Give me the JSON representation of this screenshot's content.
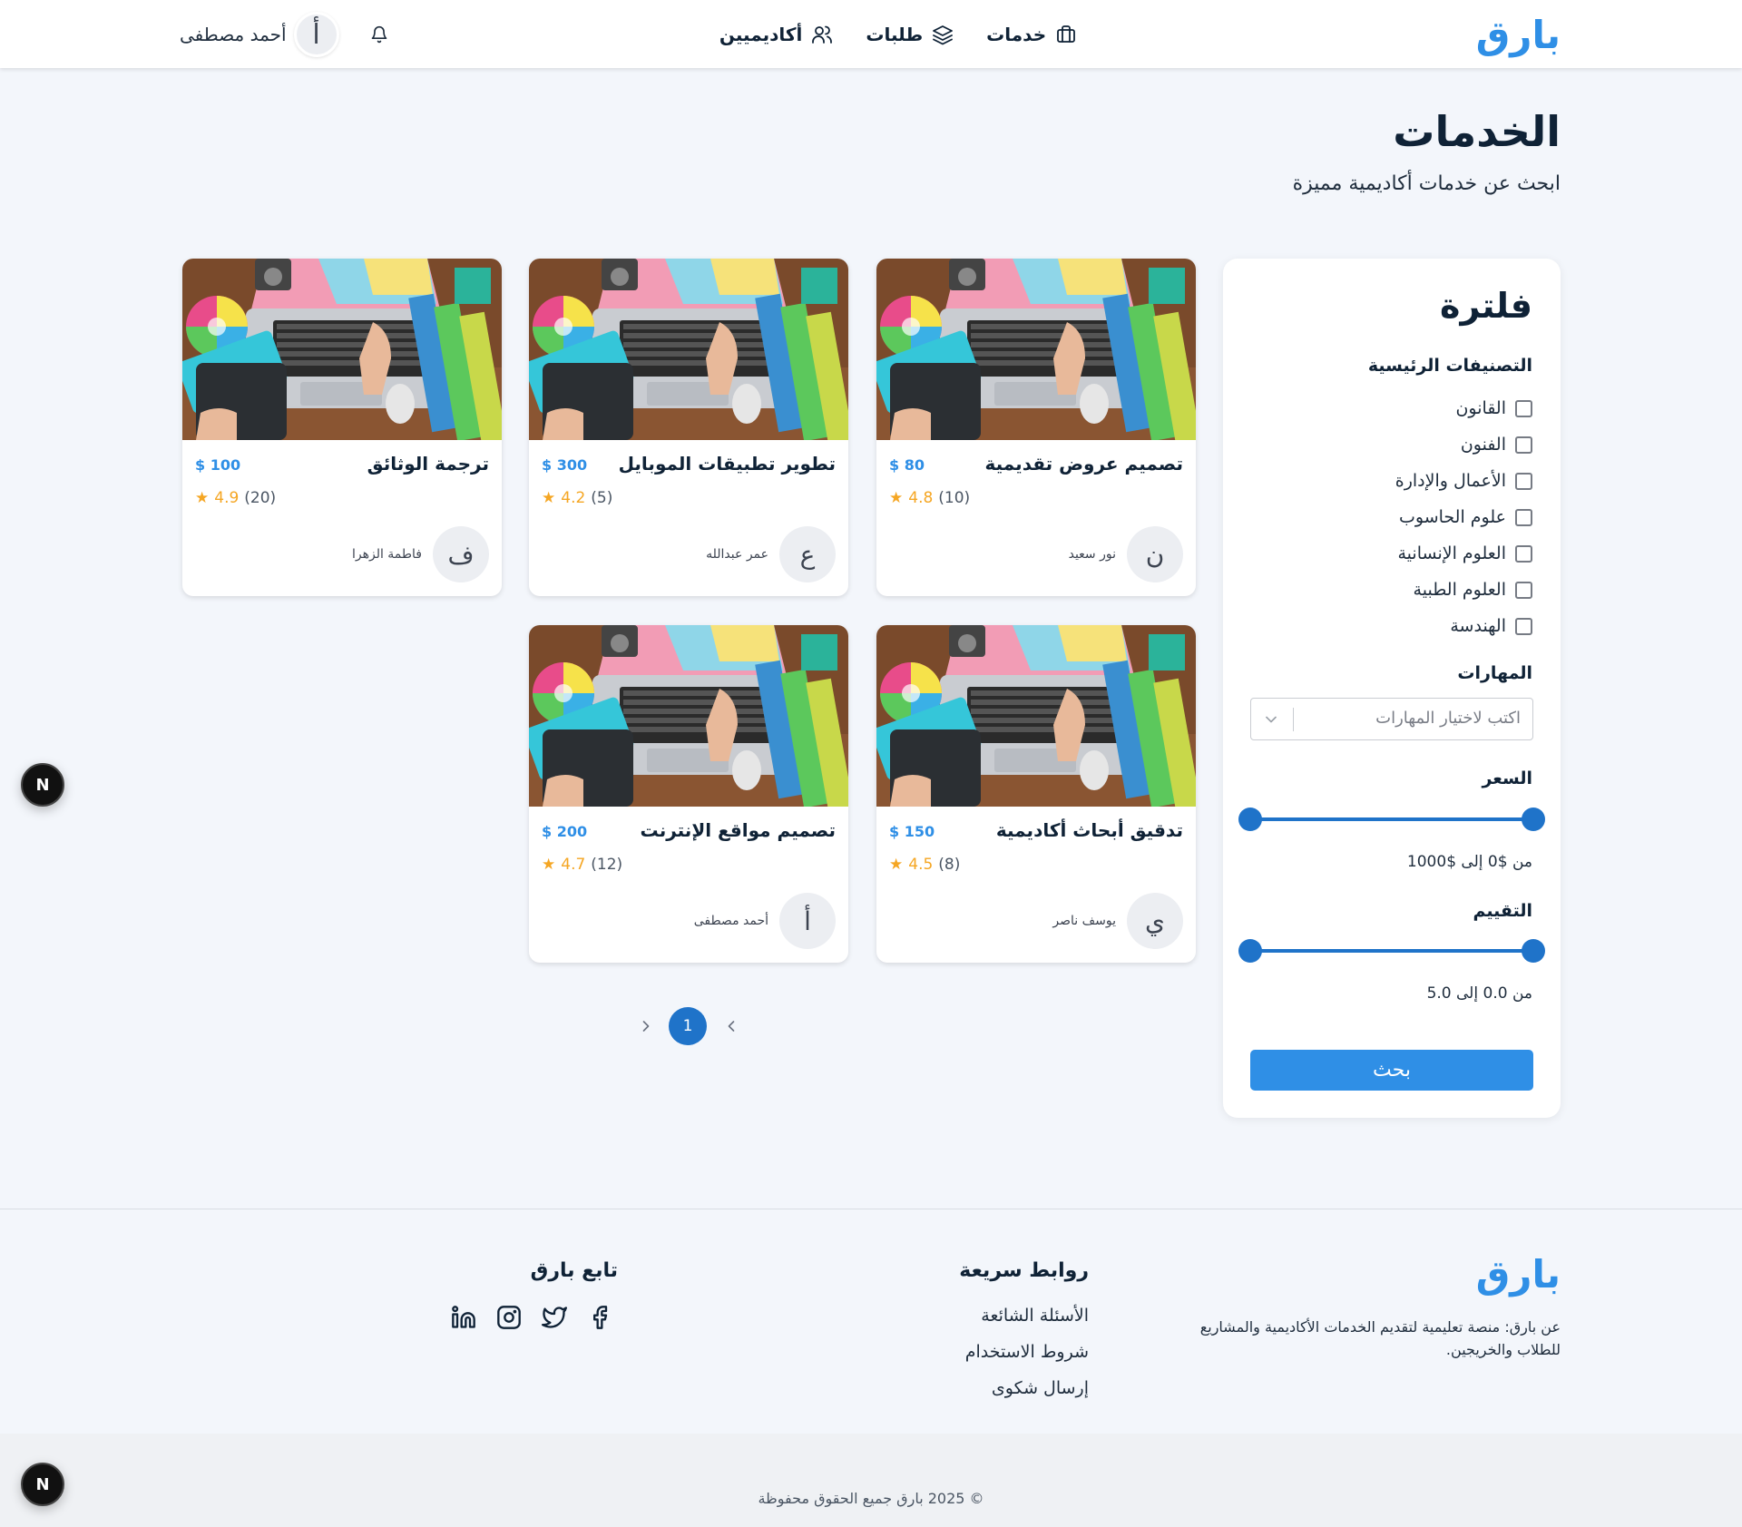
{
  "header": {
    "brand": "بارق",
    "nav": [
      {
        "label": "خدمات",
        "icon": "briefcase-icon"
      },
      {
        "label": "طلبات",
        "icon": "layers-icon"
      },
      {
        "label": "أكاديميين",
        "icon": "users-icon"
      }
    ],
    "user": {
      "name": "أحمد مصطفى",
      "initial": "أ"
    },
    "bell_icon": "bell-icon"
  },
  "page": {
    "title": "الخدمات",
    "subtitle": "ابحث عن خدمات أكاديمية مميزة"
  },
  "filter": {
    "title": "فلترة",
    "categories_title": "التصنيفات الرئيسية",
    "categories": [
      "القانون",
      "الفنون",
      "الأعمال والإدارة",
      "علوم الحاسوب",
      "العلوم الإنسانية",
      "العلوم الطبية",
      "الهندسة"
    ],
    "skills_title": "المهارات",
    "skills_placeholder": "اكتب لاختيار المهارات",
    "price_title": "السعر",
    "price_range_text": "من $0 إلى $1000",
    "rating_title": "التقييم",
    "rating_range_text": "من 0.0 إلى 5.0",
    "search_label": "بحث"
  },
  "cards": [
    {
      "title": "تصميم عروض تقديمية",
      "price": "$ 80",
      "rating": "4.8",
      "count": "(10)",
      "author": "نور سعيد",
      "initial": "ن"
    },
    {
      "title": "تطوير تطبيقات الموبايل",
      "price": "$ 300",
      "rating": "4.2",
      "count": "(5)",
      "author": "عمر عبدالله",
      "initial": "ع"
    },
    {
      "title": "ترجمة الوثائق",
      "price": "$ 100",
      "rating": "4.9",
      "count": "(20)",
      "author": "فاطمة الزهرا",
      "initial": "ف"
    },
    {
      "title": "تدقيق أبحاث أكاديمية",
      "price": "$ 150",
      "rating": "4.5",
      "count": "(8)",
      "author": "يوسف ناصر",
      "initial": "ي"
    },
    {
      "title": "تصميم مواقع الإنترنت",
      "price": "$ 200",
      "rating": "4.7",
      "count": "(12)",
      "author": "أحمد مصطفى",
      "initial": "أ"
    }
  ],
  "pagination": {
    "current": "1"
  },
  "floating_badges": [
    "N",
    "N"
  ],
  "footer": {
    "brand": "بارق",
    "about": "عن بارق: منصة تعليمية لتقديم الخدمات الأكاديمية والمشاريع للطلاب والخريجين.",
    "quick_links_title": "روابط سريعة",
    "quick_links": [
      "الأسئلة الشائعة",
      "شروط الاستخدام",
      "إرسال شكوى"
    ],
    "follow_title": "تابع بارق",
    "social_icons": [
      "facebook-icon",
      "twitter-icon",
      "instagram-icon",
      "linkedin-icon"
    ],
    "copyright": "© 2025 بارق جميع الحقوق محفوظة"
  },
  "colors": {
    "brand": "#2f8fe6",
    "accent": "#1f73c9",
    "star": "#f5a623",
    "background": "#f3f6fb"
  }
}
